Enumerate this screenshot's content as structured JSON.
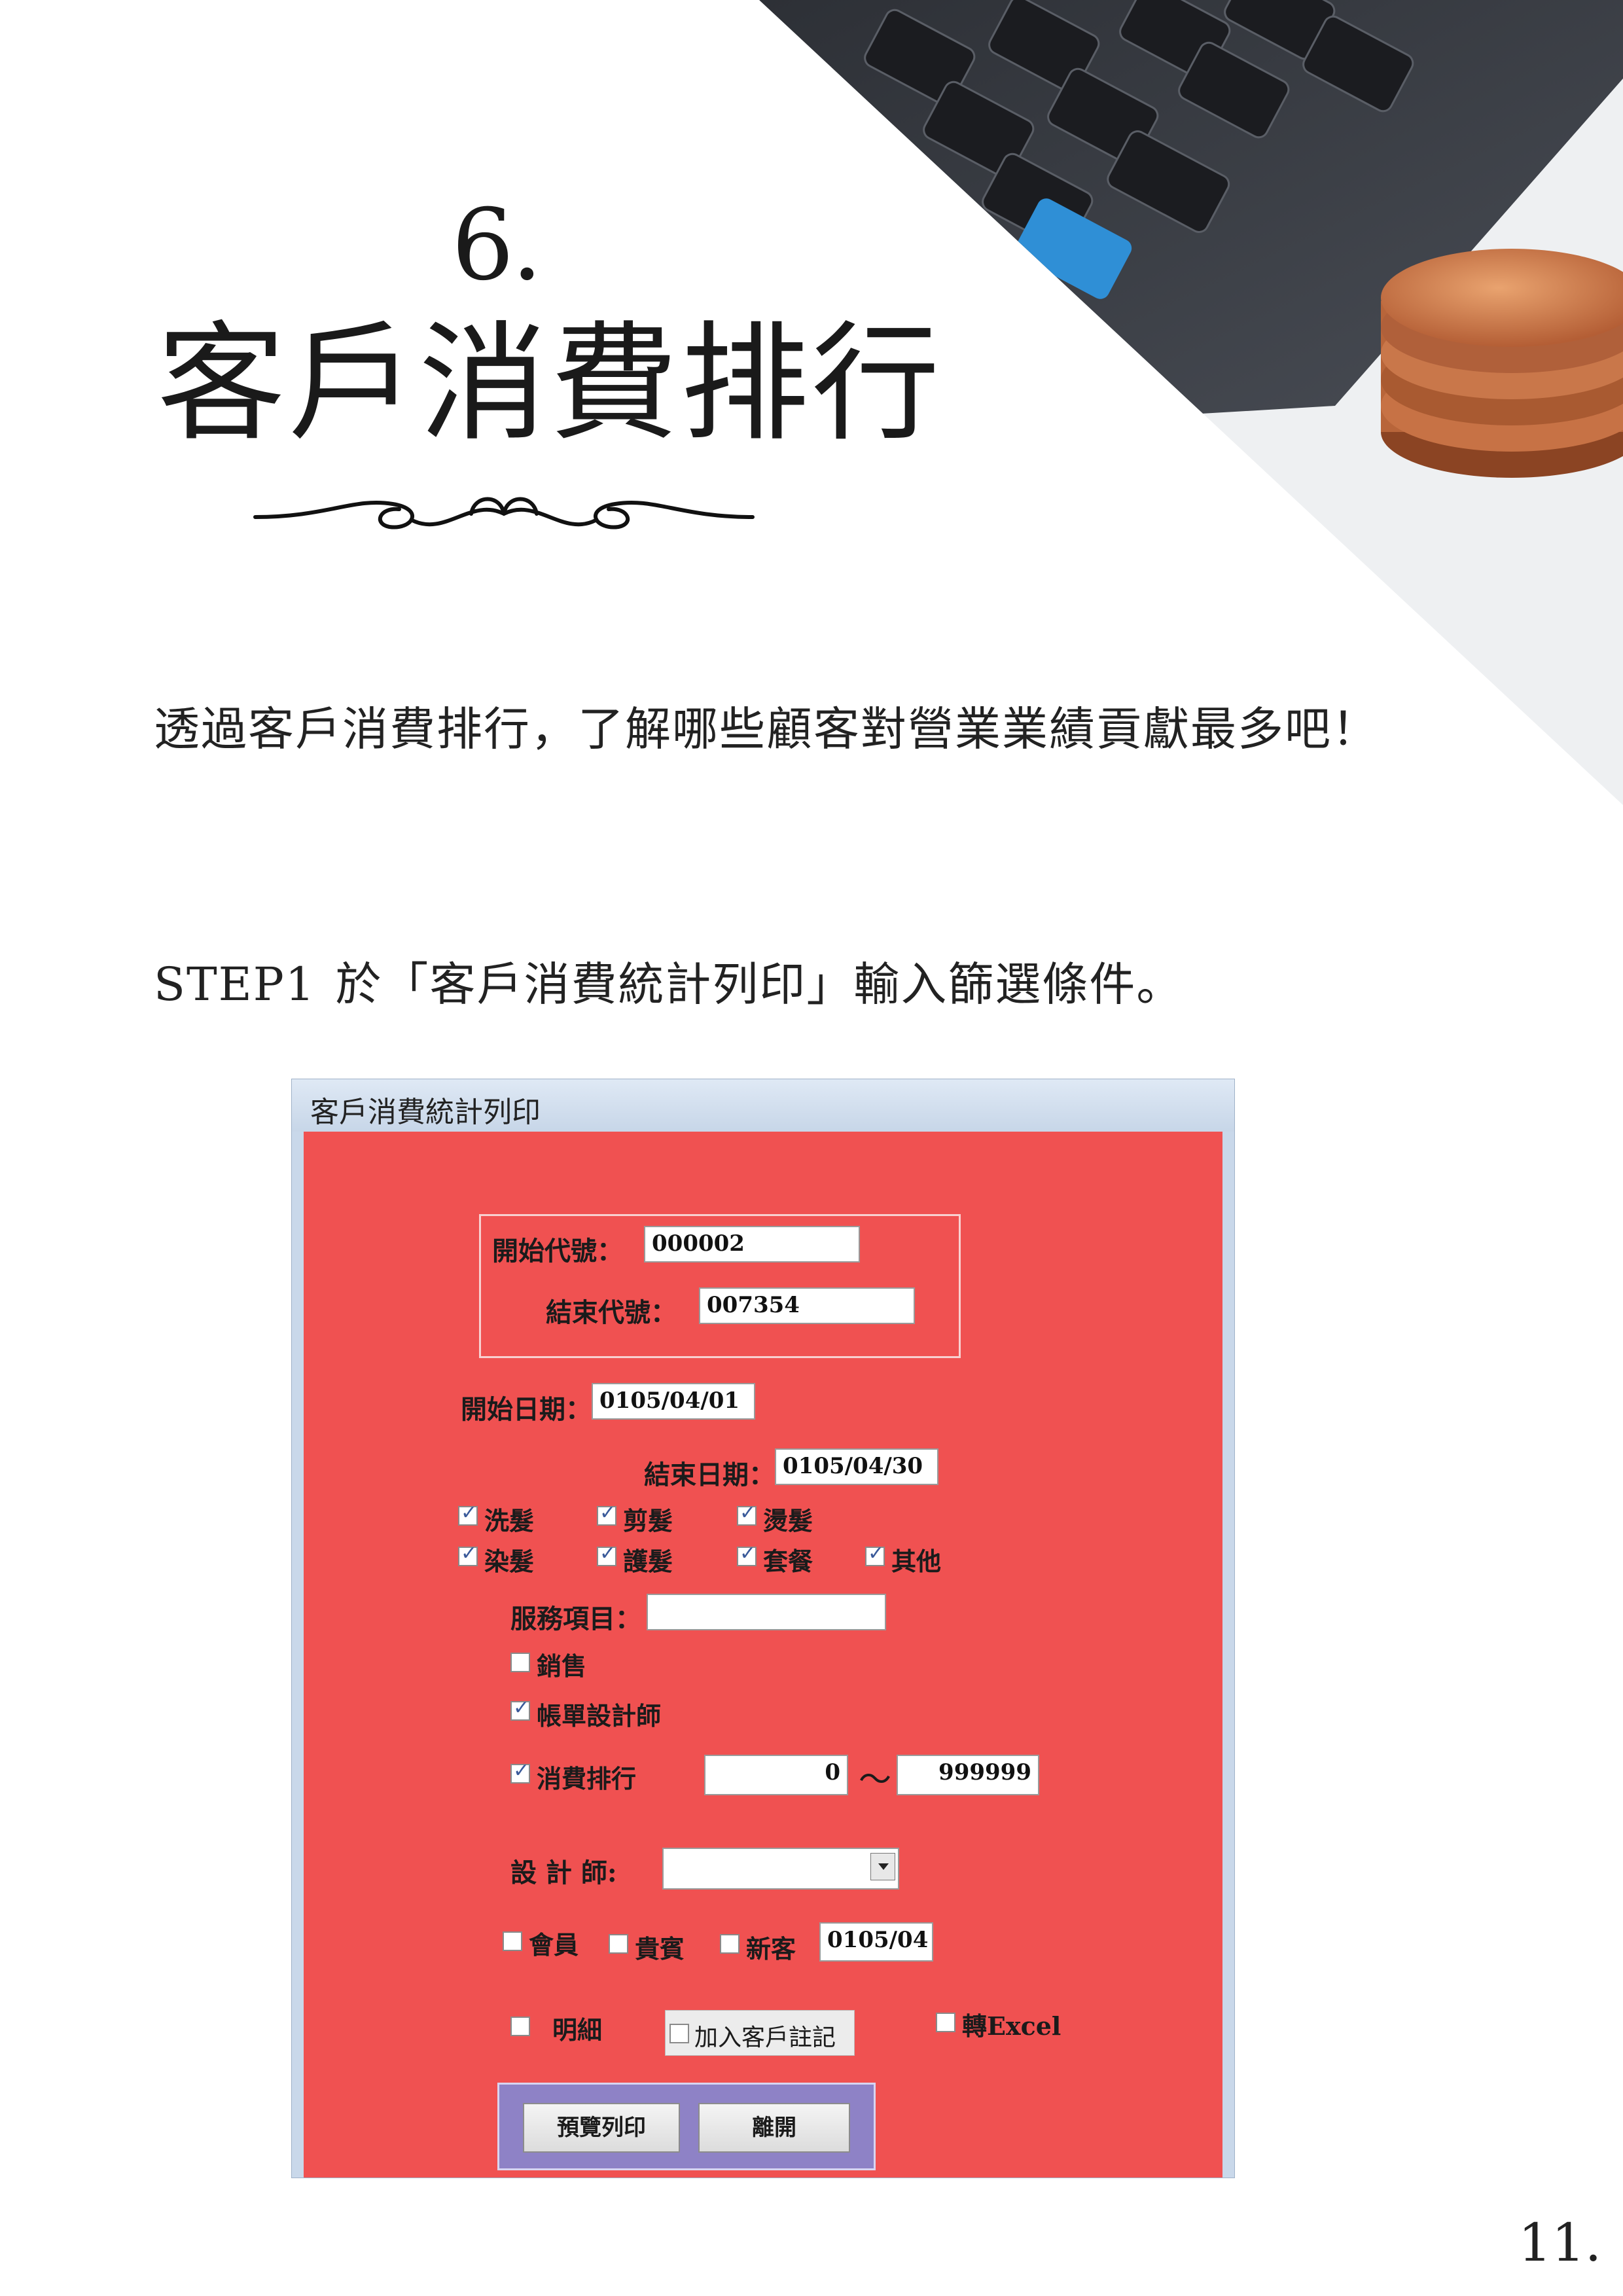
{
  "header": {
    "chapter_number": "6.",
    "chapter_title": "客戶消費排行"
  },
  "intro": "透過客戶消費排行，了解哪些顧客對營業業績貢獻最多吧！",
  "step": {
    "label": "STEP1",
    "text": "於「客戶消費統計列印」輸入篩選條件。"
  },
  "dialog": {
    "title": "客戶消費統計列印",
    "code_start": {
      "label": "開始代號：",
      "value": "000002"
    },
    "code_end": {
      "label": "結束代號：",
      "value": "007354"
    },
    "date_start": {
      "label": "開始日期：",
      "value": "0105/04/01"
    },
    "date_end": {
      "label": "結束日期：",
      "value": "0105/04/30"
    },
    "services": [
      {
        "label": "洗髮",
        "checked": true
      },
      {
        "label": "剪髮",
        "checked": true
      },
      {
        "label": "燙髮",
        "checked": true
      },
      {
        "label": "染髮",
        "checked": true
      },
      {
        "label": "護髮",
        "checked": true
      },
      {
        "label": "套餐",
        "checked": true
      },
      {
        "label": "其他",
        "checked": true
      }
    ],
    "service_item": {
      "label": "服務項目：",
      "value": ""
    },
    "sales": {
      "label": "銷售",
      "checked": false
    },
    "bill_designer": {
      "label": "帳單設計師",
      "checked": true
    },
    "ranking": {
      "label": "消費排行",
      "checked": true,
      "from": "0",
      "to": "999999",
      "separator": "～"
    },
    "designer": {
      "label": "設 計 師:",
      "value": ""
    },
    "member": {
      "label": "會員",
      "checked": false
    },
    "vip": {
      "label": "貴賓",
      "checked": false
    },
    "new_customer": {
      "label": "新客",
      "checked": false,
      "value": "0105/04"
    },
    "detail": {
      "label": "明細",
      "checked": false
    },
    "add_note": {
      "label": "加入客戶註記",
      "checked": false
    },
    "to_excel": {
      "label": "轉Excel",
      "checked": false
    },
    "preview_print_label": "預覽列印",
    "exit_label": "離開"
  },
  "page_number": "11."
}
